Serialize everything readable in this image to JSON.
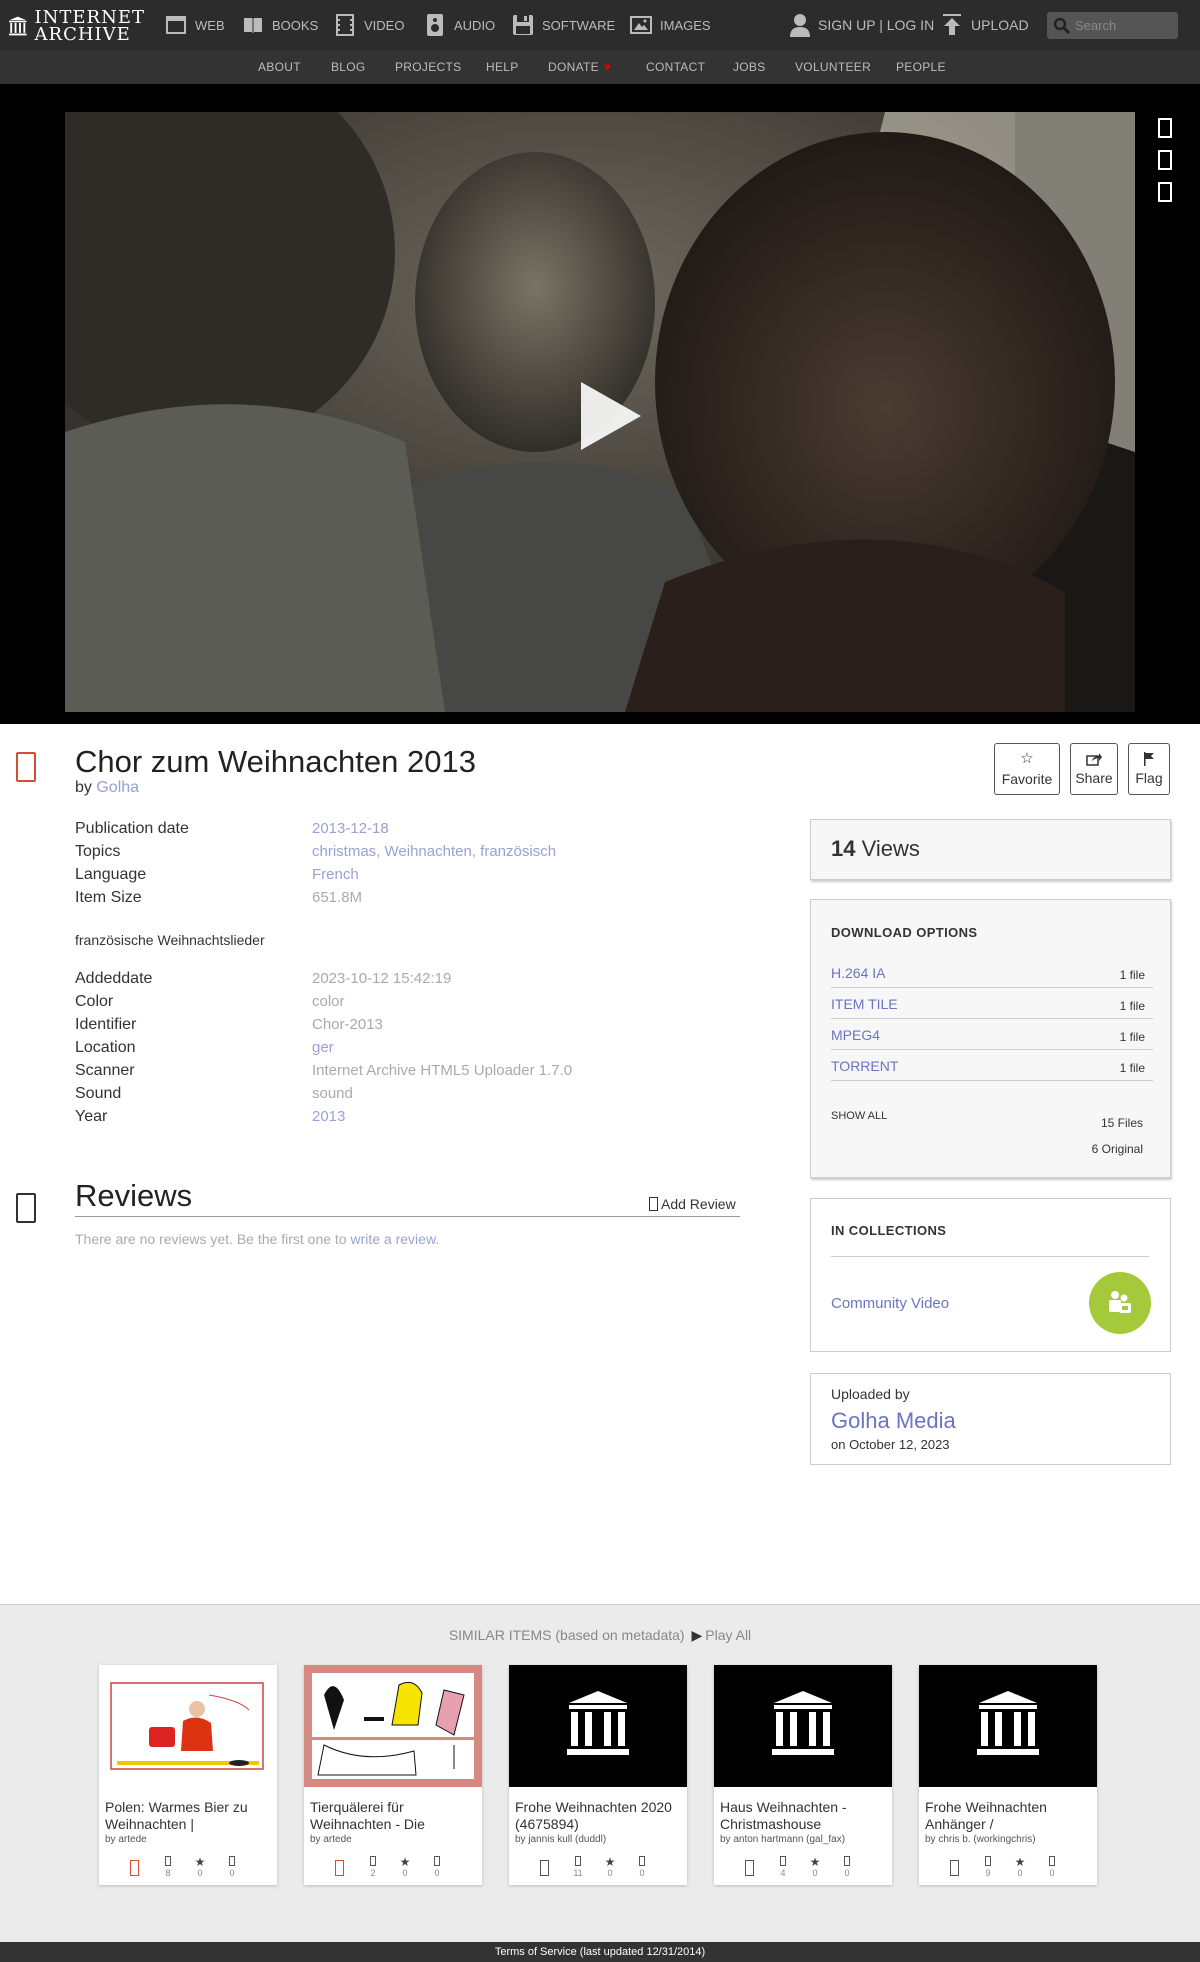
{
  "brand": {
    "line1": "INTERNET",
    "line2": "ARCHIVE"
  },
  "topnav": {
    "web": "WEB",
    "books": "BOOKS",
    "video": "VIDEO",
    "audio": "AUDIO",
    "software": "SOFTWARE",
    "images": "IMAGES",
    "signup": "SIGN UP | LOG IN",
    "upload": "UPLOAD",
    "search_placeholder": "Search"
  },
  "subnav": {
    "about": "ABOUT",
    "blog": "BLOG",
    "projects": "PROJECTS",
    "help": "HELP",
    "donate": "DONATE",
    "contact": "CONTACT",
    "jobs": "JOBS",
    "volunteer": "VOLUNTEER",
    "people": "PEOPLE"
  },
  "item": {
    "title": "Chor zum Weihnachten 2013",
    "by_label": "by",
    "creator": "Golha",
    "actions": {
      "favorite": "Favorite",
      "share": "Share",
      "flag": "Flag"
    },
    "metadata": {
      "publication_date": {
        "label": "Publication date",
        "value": "2013-12-18"
      },
      "topics": {
        "label": "Topics",
        "values": [
          "christmas",
          "Weihnachten",
          "französisch"
        ],
        "sep": ", "
      },
      "language": {
        "label": "Language",
        "value": "French"
      },
      "item_size": {
        "label": "Item Size",
        "value": "651.8M"
      },
      "addeddate": {
        "label": "Addeddate",
        "value": "2023-10-12 15:42:19"
      },
      "color": {
        "label": "Color",
        "value": "color"
      },
      "identifier": {
        "label": "Identifier",
        "value": "Chor-2013"
      },
      "location": {
        "label": "Location",
        "value": "ger"
      },
      "scanner": {
        "label": "Scanner",
        "value": "Internet Archive HTML5 Uploader 1.7.0"
      },
      "sound": {
        "label": "Sound",
        "value": "sound"
      },
      "year": {
        "label": "Year",
        "value": "2013"
      }
    },
    "description": "französische Weihnachtslieder"
  },
  "reviews": {
    "heading": "Reviews",
    "add": "Add Review",
    "empty_text": "There are no reviews yet. Be the first one to ",
    "empty_link": "write a review."
  },
  "sidebar": {
    "views_count": "14",
    "views_label": "Views",
    "download_heading": "DOWNLOAD OPTIONS",
    "downloads": [
      {
        "format": "H.264 IA",
        "count": "1 file"
      },
      {
        "format": "ITEM TILE",
        "count": "1 file"
      },
      {
        "format": "MPEG4",
        "count": "1 file"
      },
      {
        "format": "TORRENT",
        "count": "1 file"
      }
    ],
    "show_all": "SHOW ALL",
    "files_count": "15 Files",
    "original_count": "6 Original",
    "collections_heading": "IN COLLECTIONS",
    "collection": "Community Video",
    "uploaded_by_label": "Uploaded by",
    "uploader": "Golha Media",
    "uploaded_on": "on October 12, 2023"
  },
  "similar": {
    "heading": "SIMILAR ITEMS (based on metadata)",
    "play_all": "Play All",
    "items": [
      {
        "title": "Polen: Warmes Bier zu Weihnachten |",
        "by": "by artede",
        "views": "8",
        "favs": "0",
        "reviews": "0"
      },
      {
        "title": "Tierquälerei für Weihnachten - Die",
        "by": "by artede",
        "views": "2",
        "favs": "0",
        "reviews": "0"
      },
      {
        "title": "Frohe Weihnachten 2020 (4675894)",
        "by": "by jannis kull (duddl)",
        "views": "11",
        "favs": "0",
        "reviews": "0"
      },
      {
        "title": "Haus Weihnachten - Christmashouse",
        "by": "by anton hartmann (gal_fax)",
        "views": "4",
        "favs": "0",
        "reviews": "0"
      },
      {
        "title": "Frohe Weihnachten Anhänger /",
        "by": "by chris b. (workingchris)",
        "views": "9",
        "favs": "0",
        "reviews": "0"
      }
    ]
  },
  "footer": {
    "text": "Terms of Service (last updated 12/31/2014)"
  },
  "colors": {
    "accent_link": "#6b73c2",
    "muted_link": "#9aa1d4",
    "collection_badge": "#a4c93a",
    "video_type": "#d64e2f"
  }
}
